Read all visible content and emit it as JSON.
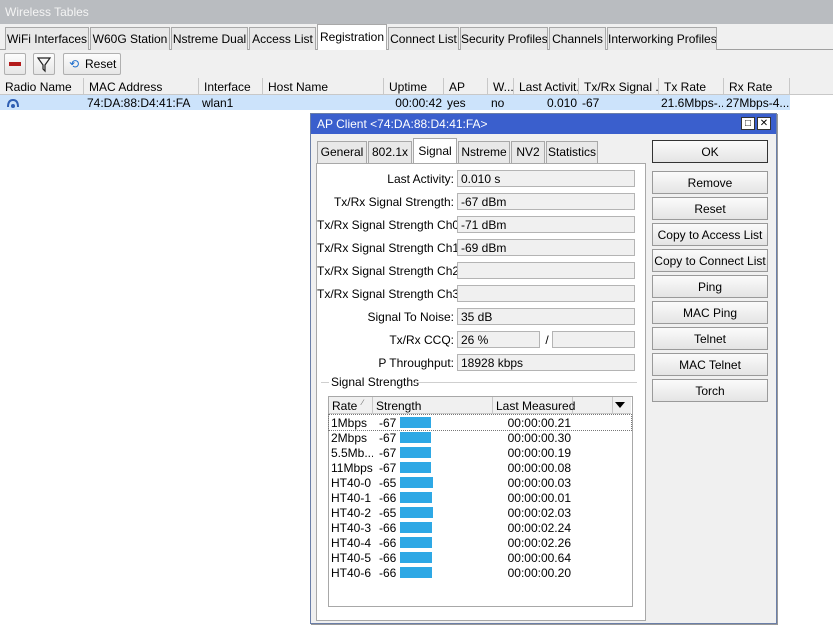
{
  "window": {
    "title": "Wireless Tables"
  },
  "tabs": [
    "WiFi Interfaces",
    "W60G Station",
    "Nstreme Dual",
    "Access List",
    "Registration",
    "Connect List",
    "Security Profiles",
    "Channels",
    "Interworking Profiles"
  ],
  "toolbar": {
    "reset_label": "Reset"
  },
  "table": {
    "columns": [
      "Radio Name",
      "MAC Address",
      "Interface",
      "Host Name",
      "Uptime",
      "AP",
      "W...",
      "Last Activit...",
      "Tx/Rx Signal ...",
      "Tx Rate",
      "Rx Rate"
    ],
    "row": {
      "radio_name": "",
      "mac": "74:DA:88:D4:41:FA",
      "interface": "wlan1",
      "host_name": "",
      "uptime": "00:00:42",
      "ap": "yes",
      "w": "no",
      "last_activity": "0.010",
      "signal": "-67",
      "tx_rate": "21.6Mbps-...",
      "rx_rate": "27Mbps-4..."
    }
  },
  "dialog": {
    "title": "AP Client <74:DA:88:D4:41:FA>",
    "tabs": [
      "General",
      "802.1x",
      "Signal",
      "Nstreme",
      "NV2",
      "Statistics"
    ],
    "fields": {
      "last_activity": {
        "label": "Last Activity:",
        "value": "0.010 s"
      },
      "signal_strength": {
        "label": "Tx/Rx Signal Strength:",
        "value": "-67 dBm"
      },
      "signal_ch0": {
        "label": "Tx/Rx Signal Strength Ch0:",
        "value": "-71 dBm"
      },
      "signal_ch1": {
        "label": "Tx/Rx Signal Strength Ch1:",
        "value": "-69 dBm"
      },
      "signal_ch2": {
        "label": "Tx/Rx Signal Strength Ch2:",
        "value": ""
      },
      "signal_ch3": {
        "label": "Tx/Rx Signal Strength Ch3:",
        "value": ""
      },
      "snr": {
        "label": "Signal To Noise:",
        "value": "35 dB"
      },
      "ccq": {
        "label": "Tx/Rx CCQ:",
        "value": "26 %",
        "value2": "",
        "sep": "/"
      },
      "throughput": {
        "label": "P Throughput:",
        "value": "18928 kbps"
      }
    },
    "group_label": "Signal Strengths",
    "strength_table": {
      "columns": [
        "Rate",
        "Strength",
        "Last Measured"
      ],
      "rows": [
        {
          "rate": "1Mbps",
          "strength": "-67",
          "last": "00:00:00.21"
        },
        {
          "rate": "2Mbps",
          "strength": "-67",
          "last": "00:00:00.30"
        },
        {
          "rate": "5.5Mb...",
          "strength": "-67",
          "last": "00:00:00.19"
        },
        {
          "rate": "11Mbps",
          "strength": "-67",
          "last": "00:00:00.08"
        },
        {
          "rate": "HT40-0",
          "strength": "-65",
          "last": "00:00:00.03"
        },
        {
          "rate": "HT40-1",
          "strength": "-66",
          "last": "00:00:00.01"
        },
        {
          "rate": "HT40-2",
          "strength": "-65",
          "last": "00:00:02.03"
        },
        {
          "rate": "HT40-3",
          "strength": "-66",
          "last": "00:00:02.24"
        },
        {
          "rate": "HT40-4",
          "strength": "-66",
          "last": "00:00:02.26"
        },
        {
          "rate": "HT40-5",
          "strength": "-66",
          "last": "00:00:00.64"
        },
        {
          "rate": "HT40-6",
          "strength": "-66",
          "last": "00:00:00.20"
        }
      ]
    },
    "buttons": [
      "OK",
      "Remove",
      "Reset",
      "Copy to Access List",
      "Copy to Connect List",
      "Ping",
      "MAC Ping",
      "Telnet",
      "MAC Telnet",
      "Torch"
    ]
  },
  "colors": {
    "accent": "#3a5fcd",
    "selection": "#cce3fb",
    "bar": "#2ea8e5"
  }
}
